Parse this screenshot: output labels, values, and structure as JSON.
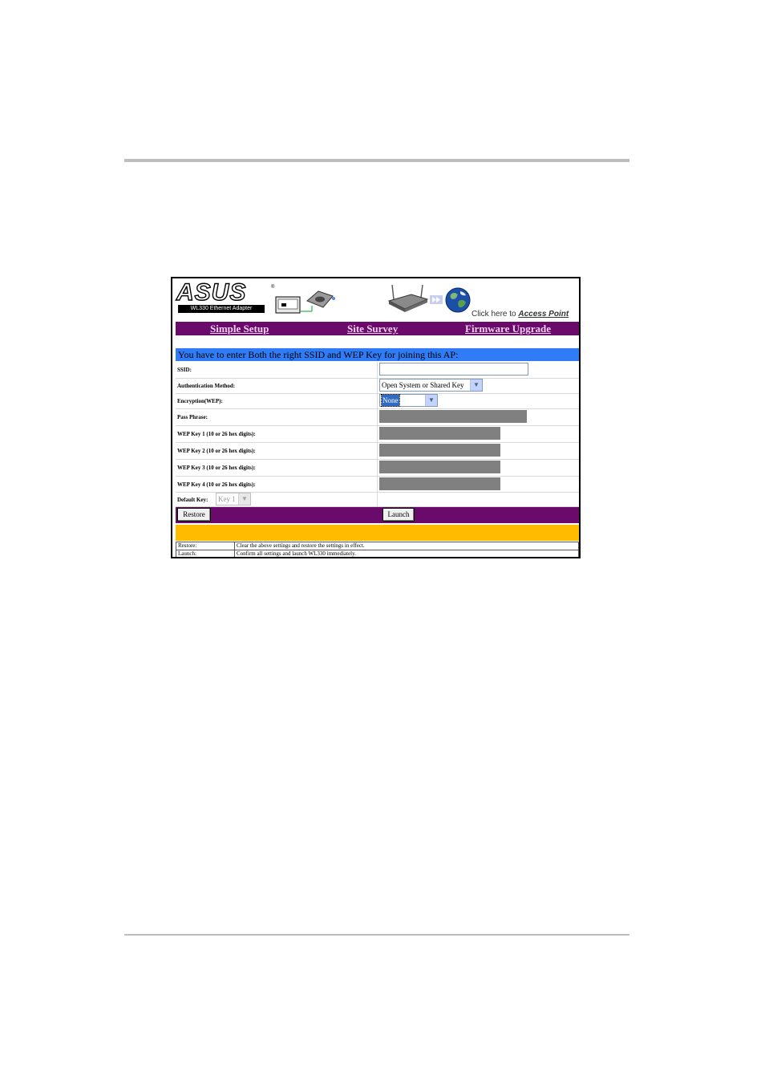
{
  "header": {
    "logo_word": "ASUS",
    "logo_registered": "®",
    "logo_subtitle": "WL330 Ethernet Adapter",
    "access_prefix": "Click here to",
    "access_link": "Access Point"
  },
  "nav": {
    "items": [
      {
        "label": "Simple Setup"
      },
      {
        "label": "Site Survey"
      },
      {
        "label": "Firmware Upgrade"
      }
    ]
  },
  "form": {
    "notice": "You have to enter Both the right SSID and WEP Key for joining this AP:",
    "ssid_label": "SSID:",
    "ssid_value": "",
    "auth_label": "Authentication Method:",
    "auth_value": "Open System or Shared Key",
    "encryption_label": "Encryption(WEP):",
    "encryption_value": "None",
    "passphrase_label": "Pass Phrase:",
    "wep_keys": [
      {
        "label": "WEP Key 1 (10 or 26 hex digits):"
      },
      {
        "label": "WEP Key 2 (10 or 26 hex digits):"
      },
      {
        "label": "WEP Key 3 (10 or 26 hex digits):"
      },
      {
        "label": "WEP Key 4 (10 or 26 hex digits):"
      }
    ],
    "default_key_label": "Default Key:",
    "default_key_value": "Key 1"
  },
  "actions": {
    "restore_label": "Restore",
    "launch_label": "Launch"
  },
  "help": [
    {
      "key": "Restore:",
      "desc": "Clear the above settings and restore the settings in effect."
    },
    {
      "key": "Launch:",
      "desc": "Confirm all settings and launch WL330 immediately."
    }
  ],
  "colors": {
    "nav_bg": "#6a0a6a",
    "notice_bg": "#2f7cf6",
    "status_bg": "#ffbb00",
    "disabled_field": "#808080"
  }
}
